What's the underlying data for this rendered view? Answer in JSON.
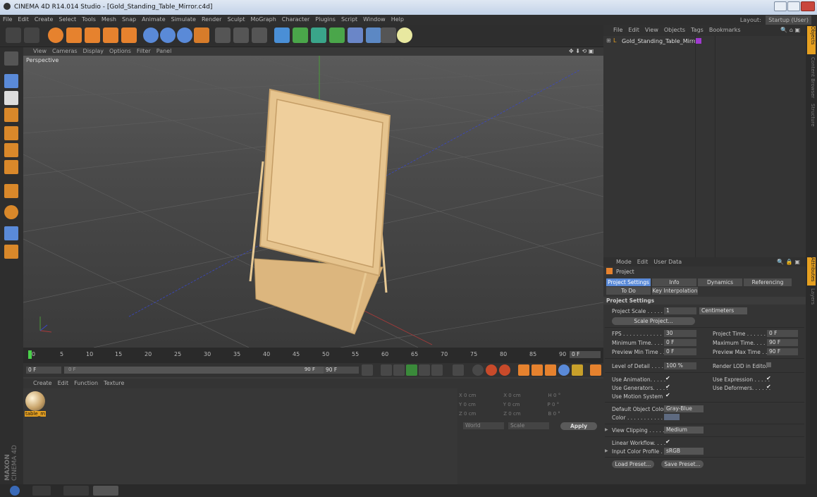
{
  "window": {
    "title": "CINEMA 4D R14.014 Studio - [Gold_Standing_Table_Mirror.c4d]"
  },
  "menubar": {
    "items": [
      "File",
      "Edit",
      "Create",
      "Select",
      "Tools",
      "Mesh",
      "Snap",
      "Animate",
      "Simulate",
      "Render",
      "Sculpt",
      "MoGraph",
      "Character",
      "Plugins",
      "Script",
      "Window",
      "Help"
    ],
    "layout_label": "Layout:",
    "layout_value": "Startup (User)"
  },
  "viewport": {
    "menu": [
      "View",
      "Cameras",
      "Display",
      "Options",
      "Filter",
      "Panel"
    ],
    "label": "Perspective"
  },
  "timeline": {
    "ticks": [
      "0",
      "5",
      "10",
      "15",
      "20",
      "25",
      "30",
      "35",
      "40",
      "45",
      "50",
      "55",
      "60",
      "65",
      "70",
      "75",
      "80",
      "85",
      "90"
    ],
    "end_field": "0 F"
  },
  "transport": {
    "current": "0 F",
    "range_start": "0 F",
    "range_end": "90 F",
    "end": "90 F"
  },
  "material_manager": {
    "menu": [
      "Create",
      "Edit",
      "Function",
      "Texture"
    ],
    "materials": [
      {
        "name": "table_m"
      }
    ]
  },
  "coordinates": {
    "rows": [
      {
        "a": "X",
        "av": "0 cm",
        "b": "X",
        "bv": "0 cm",
        "c": "H",
        "cv": "0 °"
      },
      {
        "a": "Y",
        "av": "0 cm",
        "b": "Y",
        "bv": "0 cm",
        "c": "P",
        "cv": "0 °"
      },
      {
        "a": "Z",
        "av": "0 cm",
        "b": "Z",
        "bv": "0 cm",
        "c": "B",
        "cv": "0 °"
      }
    ],
    "space": "World",
    "mode": "Scale",
    "apply": "Apply"
  },
  "object_manager": {
    "menu": [
      "File",
      "Edit",
      "View",
      "Objects",
      "Tags",
      "Bookmarks"
    ],
    "objects": [
      {
        "name": "Gold_Standing_Table_Mirror"
      }
    ]
  },
  "attribute_manager": {
    "menu": [
      "Mode",
      "Edit",
      "User Data"
    ],
    "object": "Project",
    "tabs": [
      "Project Settings",
      "Info",
      "Dynamics",
      "Referencing",
      "To Do",
      "Key Interpolation"
    ],
    "section": "Project Settings",
    "project_scale_label": "Project Scale . . . . . . .",
    "project_scale_value": "1",
    "project_scale_unit": "Centimeters",
    "scale_project_btn": "Scale Project...",
    "fps_label": "FPS . . . . . . . . . . . . . . .",
    "fps_value": "30",
    "project_time_label": "Project Time . . . . . . . .",
    "project_time_value": "0 F",
    "min_time_label": "Minimum Time. . . . . . .",
    "min_time_value": "0 F",
    "max_time_label": "Maximum Time. . . . . .",
    "max_time_value": "90 F",
    "prev_min_label": "Preview Min Time . . .",
    "prev_min_value": "0 F",
    "prev_max_label": "Preview Max Time . . .",
    "prev_max_value": "90 F",
    "lod_label": "Level of Detail . . . . . .",
    "lod_value": "100 %",
    "render_lod_label": "Render LOD in Editor",
    "use_anim_label": "Use Animation. . . . .",
    "use_expr_label": "Use Expression . . . . .",
    "use_gen_label": "Use Generators. . . . .",
    "use_def_label": "Use Deformers. . . . . .",
    "use_motion_label": "Use Motion System",
    "default_color_label": "Default Object Color",
    "default_color_value": "Gray-Blue",
    "color_label": "Color . . . . . . . . . . .",
    "view_clipping_label": "View Clipping . . . . . .",
    "view_clipping_value": "Medium",
    "linear_label": "Linear Workflow. . . .",
    "input_profile_label": "Input Color Profile . .",
    "input_profile_value": "sRGB",
    "load_preset": "Load Preset...",
    "save_preset": "Save Preset..."
  },
  "side_tabs": [
    "Objects",
    "Content Browser",
    "Structure",
    "Attributes",
    "Layers"
  ],
  "branding": {
    "maxon": "MAXON",
    "product": "CINEMA 4D"
  },
  "colors": {
    "accent": "#5a8ad8",
    "gold": "#e6c48e",
    "viewport": "#4a4a4a"
  }
}
